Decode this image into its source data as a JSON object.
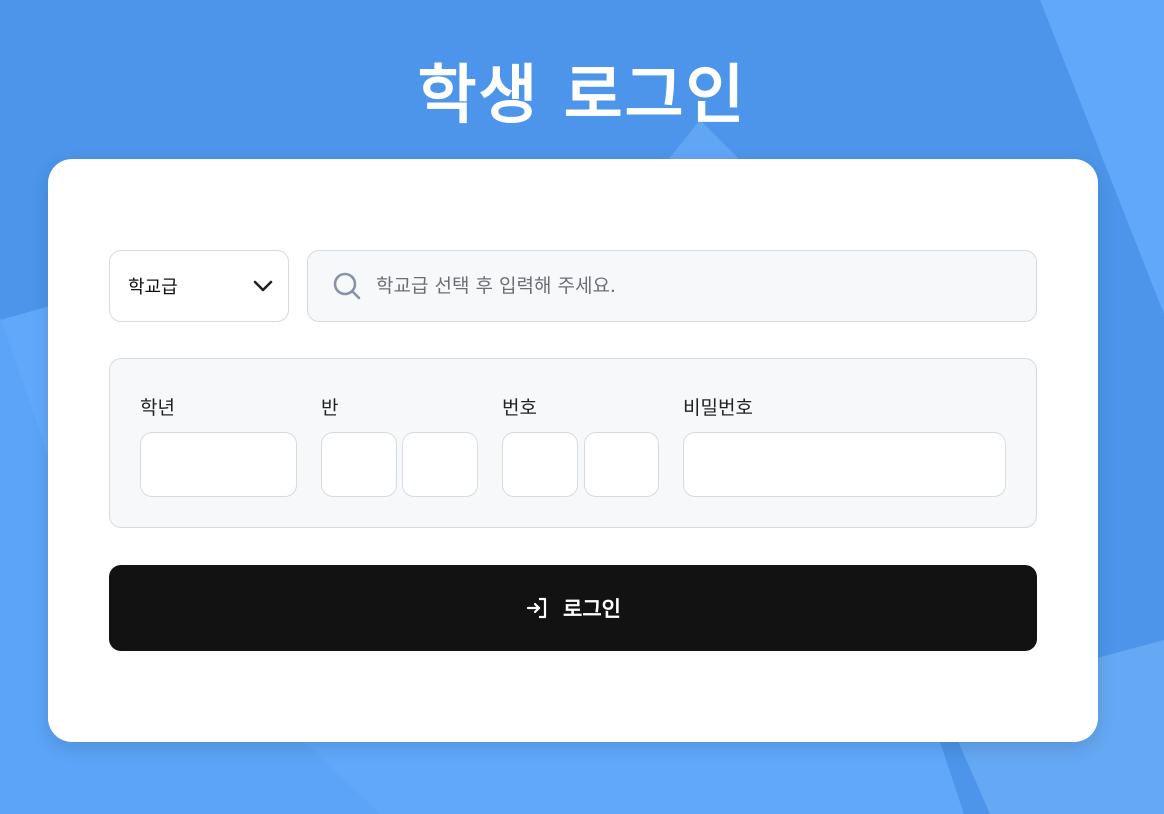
{
  "page": {
    "title": "학생 로그인"
  },
  "school_level": {
    "selected": "학교급",
    "icon": "chevron-down-icon"
  },
  "search": {
    "placeholder": "학교급 선택 후 입력해 주세요.",
    "value": "",
    "icon": "search-icon"
  },
  "fields": {
    "grade_label": "학년",
    "class_label": "반",
    "number_label": "번호",
    "password_label": "비밀번호"
  },
  "login_button": {
    "label": "로그인",
    "icon": "login-arrow-icon"
  },
  "colors": {
    "background": "#61a8fb",
    "background_shape": "#4a92e8",
    "card": "#ffffff",
    "button": "#121212",
    "panel": "#f7f8fa",
    "border": "#d5dbe3"
  }
}
